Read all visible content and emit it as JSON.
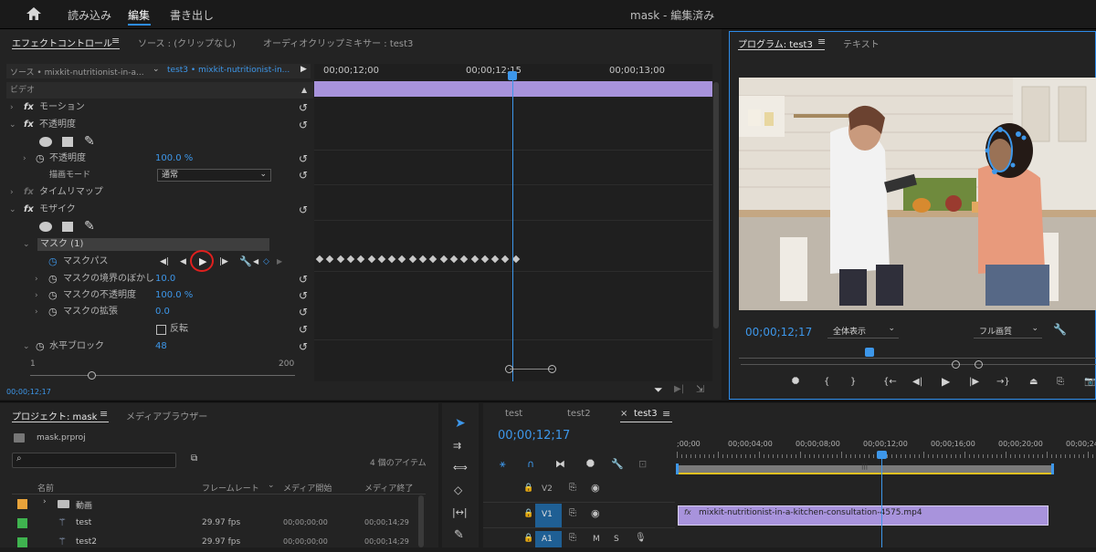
{
  "menu": {
    "items": [
      "読み込み",
      "編集",
      "書き出し"
    ],
    "title": "mask - 編集済み"
  },
  "effect_controls": {
    "tabs": [
      "エフェクトコントロール",
      "ソース : (クリップなし)",
      "オーディオクリップミキサー : test3"
    ],
    "source_clip": "ソース • mixkit-nutritionist-in-a...",
    "seq_clip": "test3 • mixkit-nutritionist-in...",
    "section": "ビデオ",
    "rows": {
      "motion": "モーション",
      "opacity": "不透明度",
      "opacity_param": "不透明度",
      "opacity_value": "100.0 %",
      "blend_label": "描画モード",
      "blend_value": "通常",
      "time_remap": "タイムリマップ",
      "mosaic": "モザイク",
      "mask": "マスク (1)",
      "mask_path": "マスクパス",
      "feather": "マスクの境界のぼかし",
      "feather_value": "10.0",
      "mask_opacity": "マスクの不透明度",
      "mask_opacity_value": "100.0 %",
      "expansion": "マスクの拡張",
      "expansion_value": "0.0",
      "invert": "反転",
      "hblocks": "水平ブロック",
      "hblocks_value": "48",
      "slider_min": "1",
      "slider_max": "200"
    },
    "timecodes": [
      "00;00;12;00",
      "00;00;12;15",
      "00;00;13;00"
    ],
    "current_time": "00;00;12;17"
  },
  "program": {
    "tabs": [
      "プログラム: test3",
      "テキスト"
    ],
    "timecode": "00;00;12;17",
    "zoom": "全体表示",
    "quality": "フル画質"
  },
  "project": {
    "tabs": [
      "プロジェクト: mask",
      "メディアブラウザー"
    ],
    "file": "mask.prproj",
    "count": "4 個のアイテム",
    "columns": [
      "名前",
      "フレームレート",
      "メディア開始",
      "メディア終了"
    ],
    "items": [
      {
        "name": "動画",
        "rate": "",
        "start": "",
        "end": "",
        "color": "#e8a33a",
        "type": "folder"
      },
      {
        "name": "test",
        "rate": "29.97 fps",
        "start": "00;00;00;00",
        "end": "00;00;14;29",
        "color": "#3fb34f",
        "type": "sequence"
      },
      {
        "name": "test2",
        "rate": "29.97 fps",
        "start": "00;00;00;00",
        "end": "00;00;14;29",
        "color": "#3fb34f",
        "type": "sequence"
      }
    ]
  },
  "timeline": {
    "tabs": [
      "test",
      "test2",
      "test3"
    ],
    "timecode": "00;00;12;17",
    "ruler": [
      ";00;00",
      "00;00;04;00",
      "00;00;08;00",
      "00;00;12;00",
      "00;00;16;00",
      "00;00;20;00",
      "00;00;24;00"
    ],
    "tracks": [
      "V2",
      "V1",
      "A1"
    ],
    "clip": "mixkit-nutritionist-in-a-kitchen-consultation-4575.mp4",
    "track_btns": [
      "M",
      "S"
    ],
    "work_area_marker": "|||"
  }
}
